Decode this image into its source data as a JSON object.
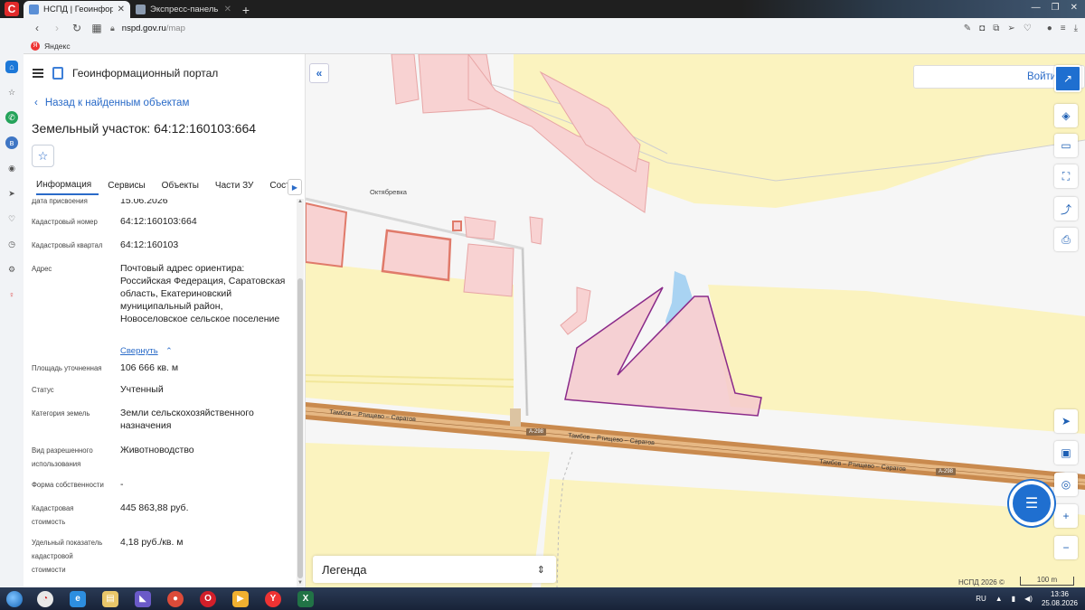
{
  "browser": {
    "tabs": [
      {
        "title": "НСПД | Геоинформационн",
        "active": true
      },
      {
        "title": "Экспресс-панель",
        "active": false
      }
    ],
    "url_host": "nspd.gov.ru",
    "url_path": "/map",
    "bookmark": "Яндекс"
  },
  "portal": {
    "title": "Геоинформационный портал",
    "back_link": "Назад к найденным объектам",
    "object_title": "Земельный участок: 64:12:160103:664",
    "tabs": [
      "Информация",
      "Сервисы",
      "Объекты",
      "Части ЗУ",
      "Состав"
    ]
  },
  "info_rows": [
    {
      "label": "Дата присвоения",
      "value": "15.06.2026"
    },
    {
      "label": "Кадастровый номер",
      "value": "64:12:160103:664"
    },
    {
      "label": "Кадастровый квартал",
      "value": "64:12:160103"
    },
    {
      "label": "Адрес",
      "value": "Почтовый адрес ориентира: Российская Федерация, Саратовская область, Екатериновский муниципальный район, Новоселовское сельское поселение"
    },
    {
      "label": "Площадь уточненная",
      "value": "106 666 кв. м"
    },
    {
      "label": "Статус",
      "value": "Учтенный"
    },
    {
      "label": "Категория земель",
      "value": "Земли сельскохозяйственного назначения"
    },
    {
      "label": "Вид разрешенного использования",
      "value": "Животноводство"
    },
    {
      "label": "Форма собственности",
      "value": "-"
    },
    {
      "label": "Кадастровая стоимость",
      "value": "445 863,88 руб."
    },
    {
      "label": "Удельный показатель кадастровой стоимости",
      "value": "4,18 руб./кв. м"
    }
  ],
  "collapse_label": "Свернуть",
  "map": {
    "search_placeholder": "Войти",
    "legend_label": "Легенда",
    "village_label": "Октябревка",
    "road_label_1": "Тамбов – Ртищево – Саратов",
    "road_label_2": "Тамбов – Ртищево – Саратов",
    "road_label_3": "Тамбов – Ртищево – Саратов",
    "road_shield": "А-298",
    "copyright": "НСПД 2026 ©",
    "scale_label": "100 m",
    "colors": {
      "parcel_fill": "#f4c9cc",
      "parcel_outline": "#8a2a8a",
      "field": "#fbf3bf",
      "road": "#c98a4e"
    }
  },
  "taskbar": {
    "language": "RU",
    "time": "13:36",
    "date": "25.08.2026"
  }
}
